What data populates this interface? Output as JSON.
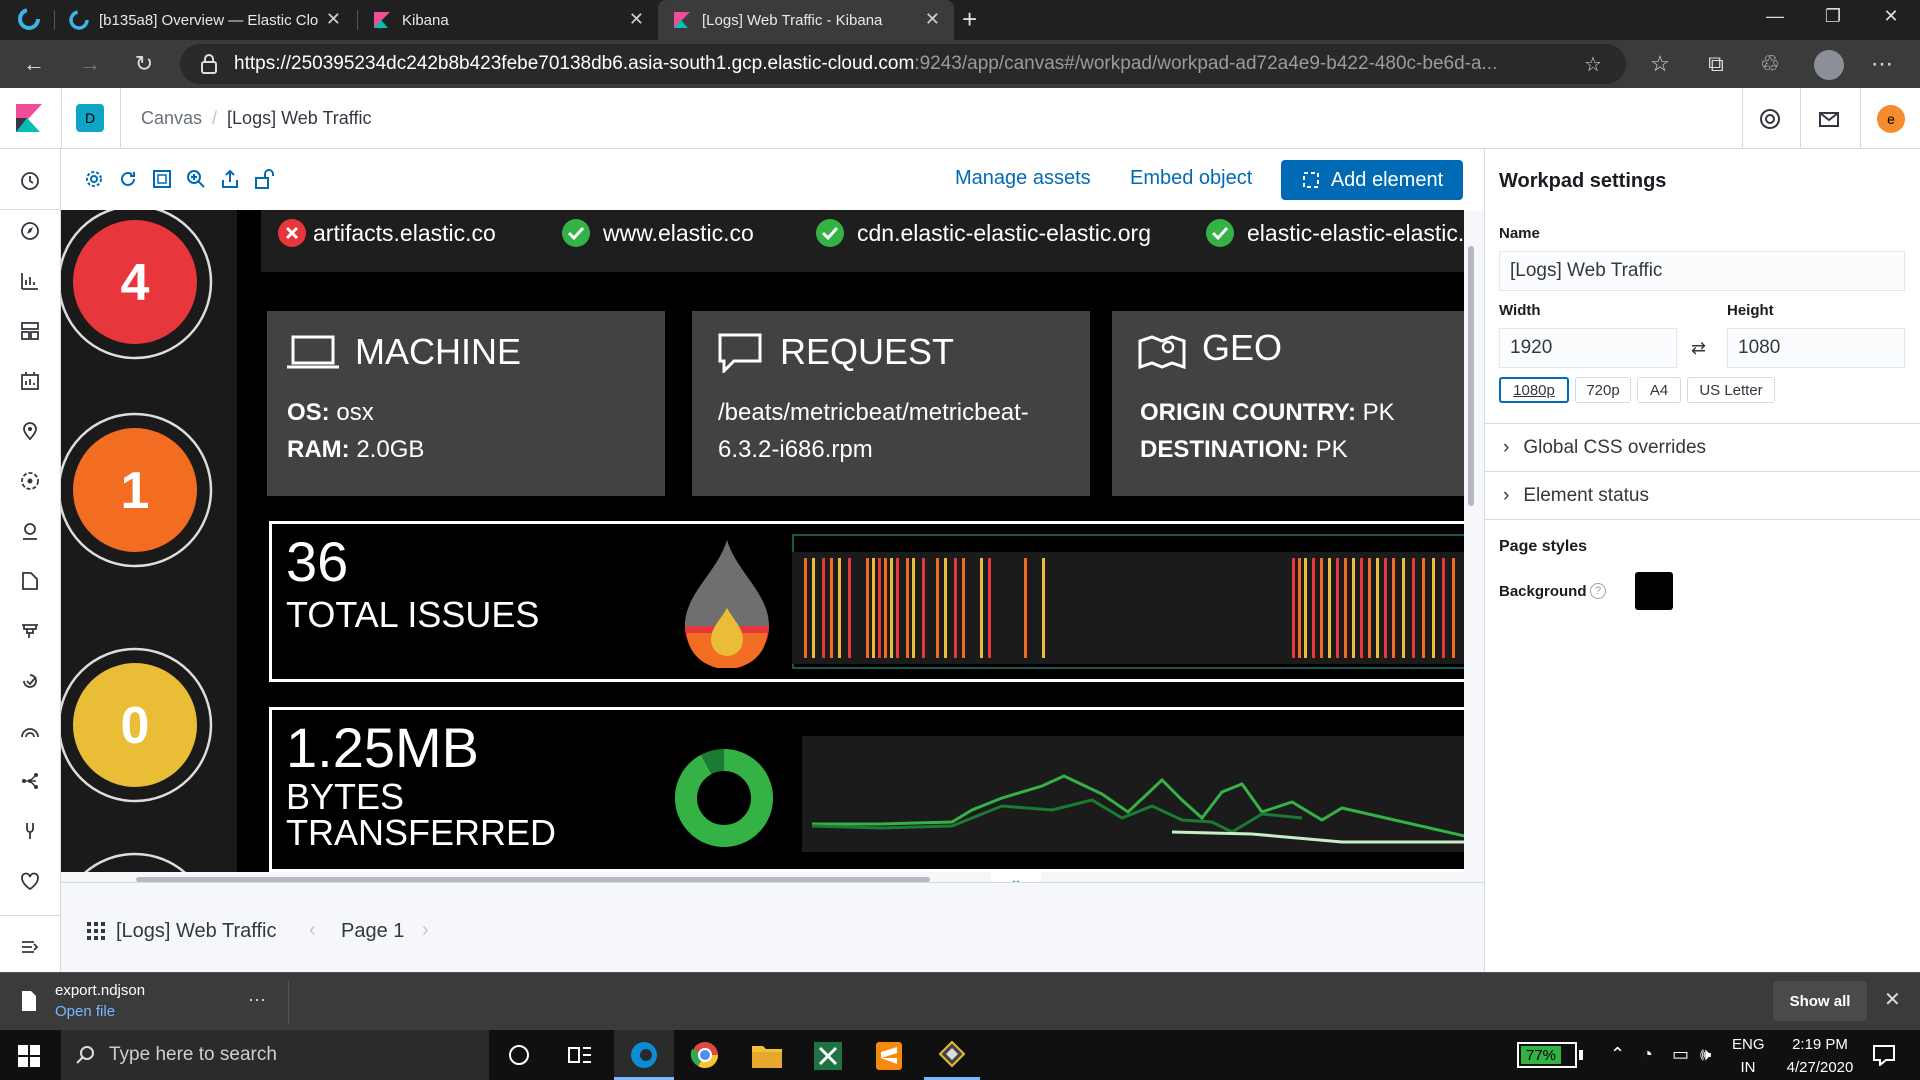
{
  "browser": {
    "tabs": [
      {
        "title": "[b135a8] Overview — Elastic Clo"
      },
      {
        "title": "Kibana"
      },
      {
        "title": "[Logs] Web Traffic - Kibana"
      }
    ],
    "new_tab": "+",
    "url_main": "https://250395234dc242b8b423febe70138db6.asia-south1.gcp.elastic-cloud.com",
    "url_rest": ":9243/app/canvas#/workpad/workpad-ad72a4e9-b422-480c-be6d-a..."
  },
  "kibana_header": {
    "space": "D",
    "breadcrumb": [
      "Canvas",
      "[Logs] Web Traffic"
    ],
    "separator": "/",
    "user_initial": "e"
  },
  "toolbar": {
    "manage_assets": "Manage assets",
    "embed_object": "Embed object",
    "add_element": "Add element"
  },
  "workpad": {
    "status_counts": [
      {
        "value": "4",
        "color": "#e7373c"
      },
      {
        "value": "1",
        "color": "#f26c22"
      },
      {
        "value": "0",
        "color": "#e9bd35"
      }
    ],
    "sites": [
      {
        "name": "artifacts.elastic.co",
        "ok": false
      },
      {
        "name": "www.elastic.co",
        "ok": true
      },
      {
        "name": "cdn.elastic-elastic-elastic.org",
        "ok": true
      },
      {
        "name": "elastic-elastic-elastic.",
        "ok": true
      }
    ],
    "machine": {
      "title": "MACHINE",
      "os_label": "OS:",
      "os": "osx",
      "ram_label": "RAM:",
      "ram": "2.0GB"
    },
    "request": {
      "title": "REQUEST",
      "path": "/beats/metricbeat/metricbeat-",
      "path2": "6.3.2-i686.rpm"
    },
    "geo": {
      "title": "GEO",
      "origin_label": "ORIGIN COUNTRY:",
      "origin": "PK",
      "dest_label": "DESTINATION:",
      "dest": "PK"
    },
    "issues": {
      "value": "36",
      "label": "TOTAL ISSUES"
    },
    "bytes": {
      "value": "1.25MB",
      "label1": "BYTES",
      "label2": "TRANSFERRED",
      "donut_fraction": 0.92
    }
  },
  "settings": {
    "title": "Workpad settings",
    "name_label": "Name",
    "name_value": "[Logs] Web Traffic",
    "width_label": "Width",
    "width_value": "1920",
    "height_label": "Height",
    "height_value": "1080",
    "presets": [
      "1080p",
      "720p",
      "A4",
      "US Letter"
    ],
    "global_css": "Global CSS overrides",
    "element_status": "Element status",
    "page_styles": "Page styles",
    "background_label": "Background",
    "background_color": "#000000"
  },
  "pagebar": {
    "workpad_name": "[Logs] Web Traffic",
    "page": "Page 1"
  },
  "download": {
    "filename": "export.ndjson",
    "open": "Open file",
    "more": "···",
    "show_all": "Show all"
  },
  "taskbar": {
    "search_placeholder": "Type here to search",
    "battery": "77%",
    "lang1": "ENG",
    "lang2": "IN",
    "time": "2:19 PM",
    "date": "4/27/2020"
  }
}
